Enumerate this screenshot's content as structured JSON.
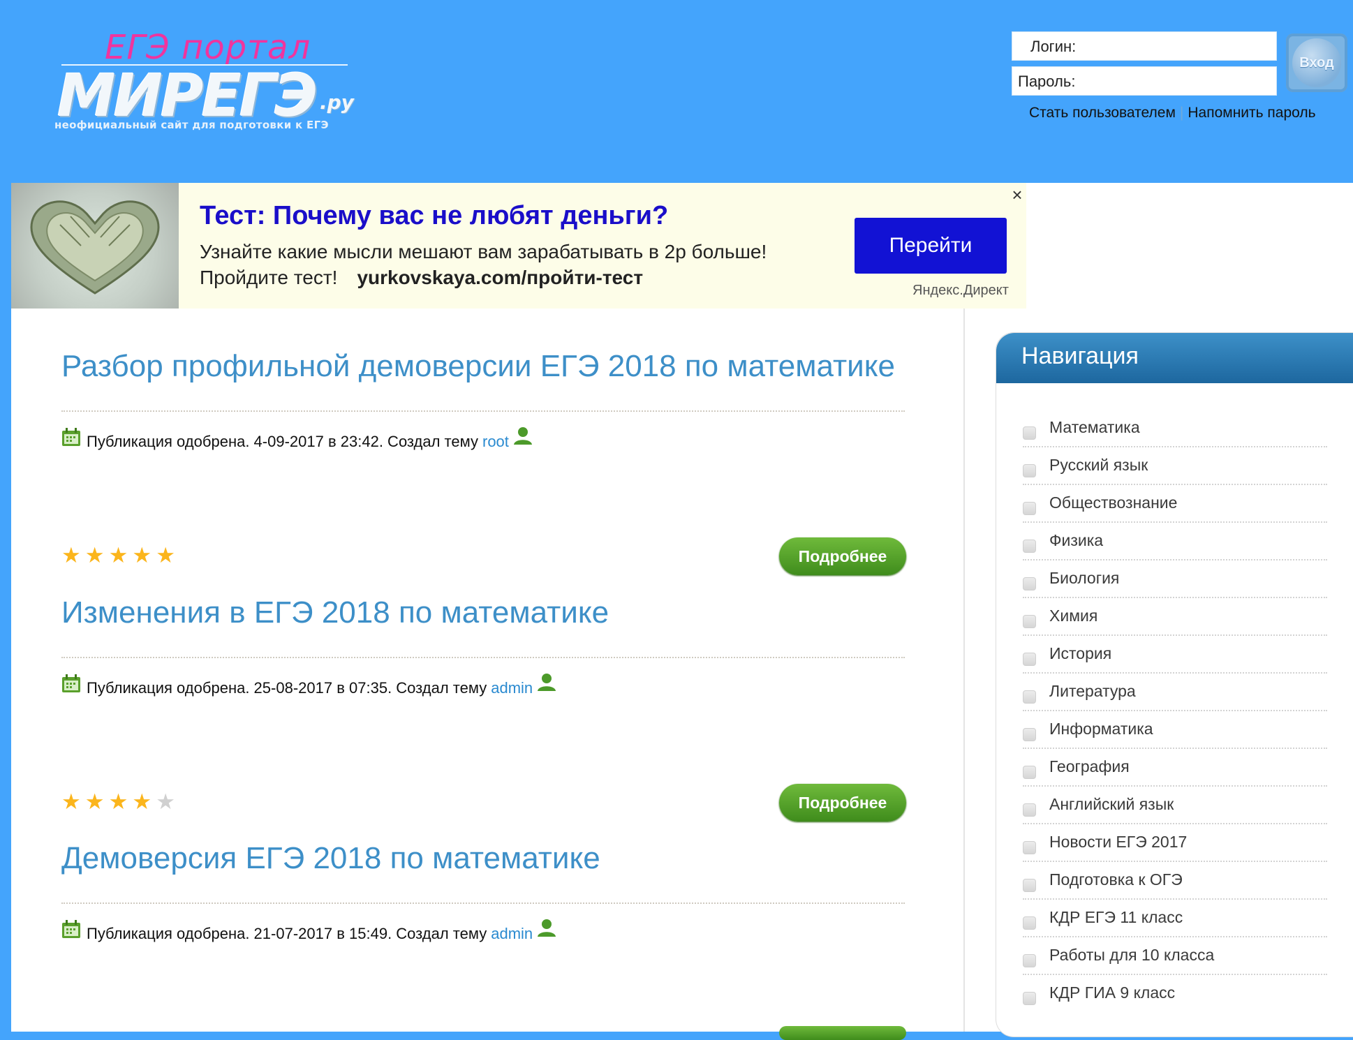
{
  "header": {
    "logo_portal": "ЕГЭ портал",
    "logo_main": "МИРЕГЭ",
    "logo_domain": ".ру",
    "logo_subtitle": "неофициальный сайт для подготовки к ЕГЭ",
    "login_label": "Логин:",
    "password_label": "Пароль:",
    "login_button": "Вход",
    "register_link": "Стать пользователем",
    "links_separator": "|",
    "remind_link": "Напомнить пароль"
  },
  "ad": {
    "title": "Тест: Почему вас не любят деньги?",
    "text_line1": "Узнайте какие мысли мешают вам зарабатывать в 2р больше!",
    "text_line2": "Пройдите тест!",
    "link": "yurkovskaya.com/пройти-тест",
    "button": "Перейти",
    "close": "×",
    "source": "Яндекс.Директ"
  },
  "posts": [
    {
      "title": "Разбор профильной демоверсии ЕГЭ 2018 по математике",
      "meta": "Публикация одобрена. 4-09-2017 в 23:42. Создал тему",
      "author": "root",
      "rating": 5,
      "more": "Подробнее"
    },
    {
      "title": "Изменения в ЕГЭ 2018 по математике",
      "meta": "Публикация одобрена. 25-08-2017 в 07:35. Создал тему",
      "author": "admin",
      "rating": 4,
      "more": "Подробнее"
    },
    {
      "title": "Демоверсия ЕГЭ 2018 по математике",
      "meta": "Публикация одобрена. 21-07-2017 в 15:49. Создал тему",
      "author": "admin"
    }
  ],
  "sidebar": {
    "title": "Навигация",
    "items": [
      "Математика",
      "Русский язык",
      "Обществознание",
      "Физика",
      "Биология",
      "Химия",
      "История",
      "Литература",
      "Информатика",
      "География",
      "Английский язык",
      "Новости ЕГЭ 2017",
      "Подготовка к ОГЭ",
      "КДР ЕГЭ 11 класс",
      "Работы для 10 класса",
      "КДР ГИА 9 класс"
    ]
  },
  "colors": {
    "header_bg": "#44a4fc",
    "title_blue": "#3d8fc8",
    "ad_title": "#1a0ec9",
    "ad_button": "#1212d4",
    "more_button_green": "#4f9f28",
    "star_on": "#fbb51c",
    "star_off": "#d0d0d0"
  },
  "icons": {
    "calendar": "calendar-icon",
    "user": "user-icon",
    "star": "star-icon",
    "close": "close-icon",
    "checkbox": "checkbox-icon"
  }
}
